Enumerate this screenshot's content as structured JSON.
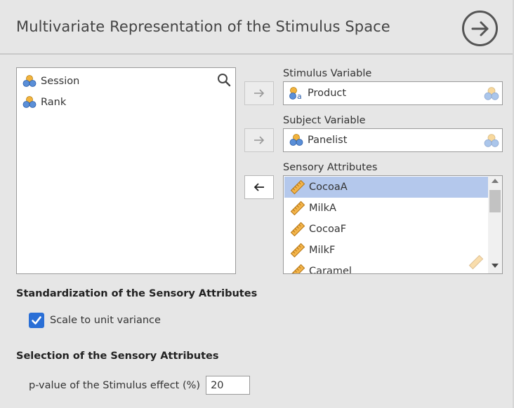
{
  "header": {
    "title": "Multivariate Representation of the Stimulus Space"
  },
  "variables": {
    "items": [
      {
        "label": "Session",
        "icon": "nominal-icon"
      },
      {
        "label": "Rank",
        "icon": "nominal-icon"
      }
    ]
  },
  "stimulus": {
    "label": "Stimulus Variable",
    "value": "Product",
    "icon": "nominal-text-icon"
  },
  "subject": {
    "label": "Subject Variable",
    "value": "Panelist",
    "icon": "nominal-icon"
  },
  "attributes": {
    "label": "Sensory Attributes",
    "items": [
      {
        "label": "CocoaA",
        "selected": true
      },
      {
        "label": "MilkA",
        "selected": false
      },
      {
        "label": "CocoaF",
        "selected": false
      },
      {
        "label": "MilkF",
        "selected": false
      },
      {
        "label": "Caramel",
        "selected": false
      }
    ]
  },
  "standardization": {
    "heading": "Standardization of the Sensory Attributes",
    "scale_label": "Scale to unit variance",
    "scale_checked": true
  },
  "selection": {
    "heading": "Selection of the Sensory Attributes",
    "pvalue_label": "p-value of the Stimulus effect (%)",
    "pvalue": "20"
  },
  "colors": {
    "accent": "#2a6fd6",
    "selected_row": "#b4c8ec",
    "ruler": "#e8a838"
  }
}
